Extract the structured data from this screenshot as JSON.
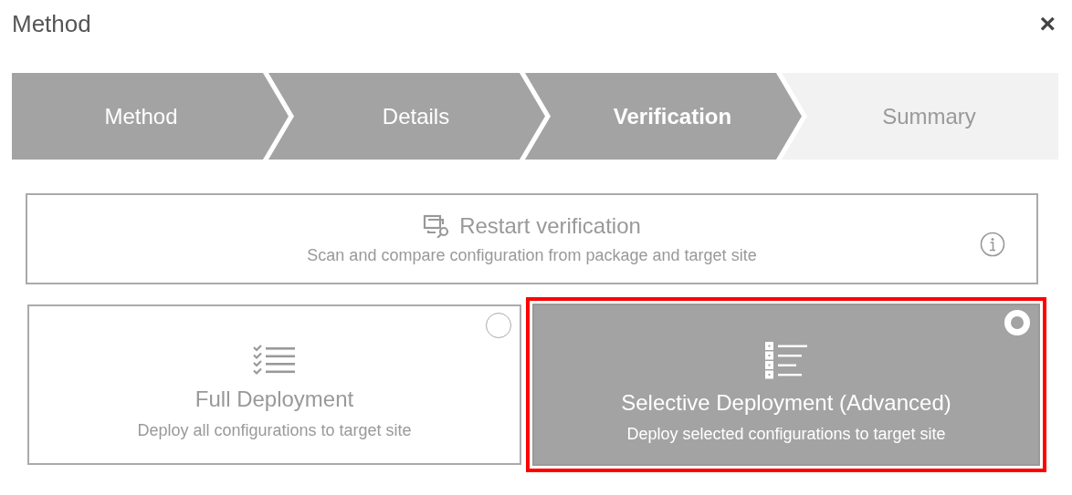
{
  "dialog": {
    "title": "Method",
    "close": "×"
  },
  "steps": [
    {
      "label": "Method",
      "completed": true,
      "selected": false
    },
    {
      "label": "Details",
      "completed": true,
      "selected": false
    },
    {
      "label": "Verification",
      "completed": false,
      "selected": true
    },
    {
      "label": "Summary",
      "completed": false,
      "selected": false
    }
  ],
  "restart": {
    "title": "Restart verification",
    "description": "Scan and compare configuration from package and target site"
  },
  "options": [
    {
      "kind": "checklist",
      "title": "Full Deployment",
      "description": "Deploy all configurations to target site",
      "selected": false
    },
    {
      "kind": "boxlist",
      "title": "Selective Deployment (Advanced)",
      "description": "Deploy selected configurations to target site",
      "selected": true
    }
  ]
}
